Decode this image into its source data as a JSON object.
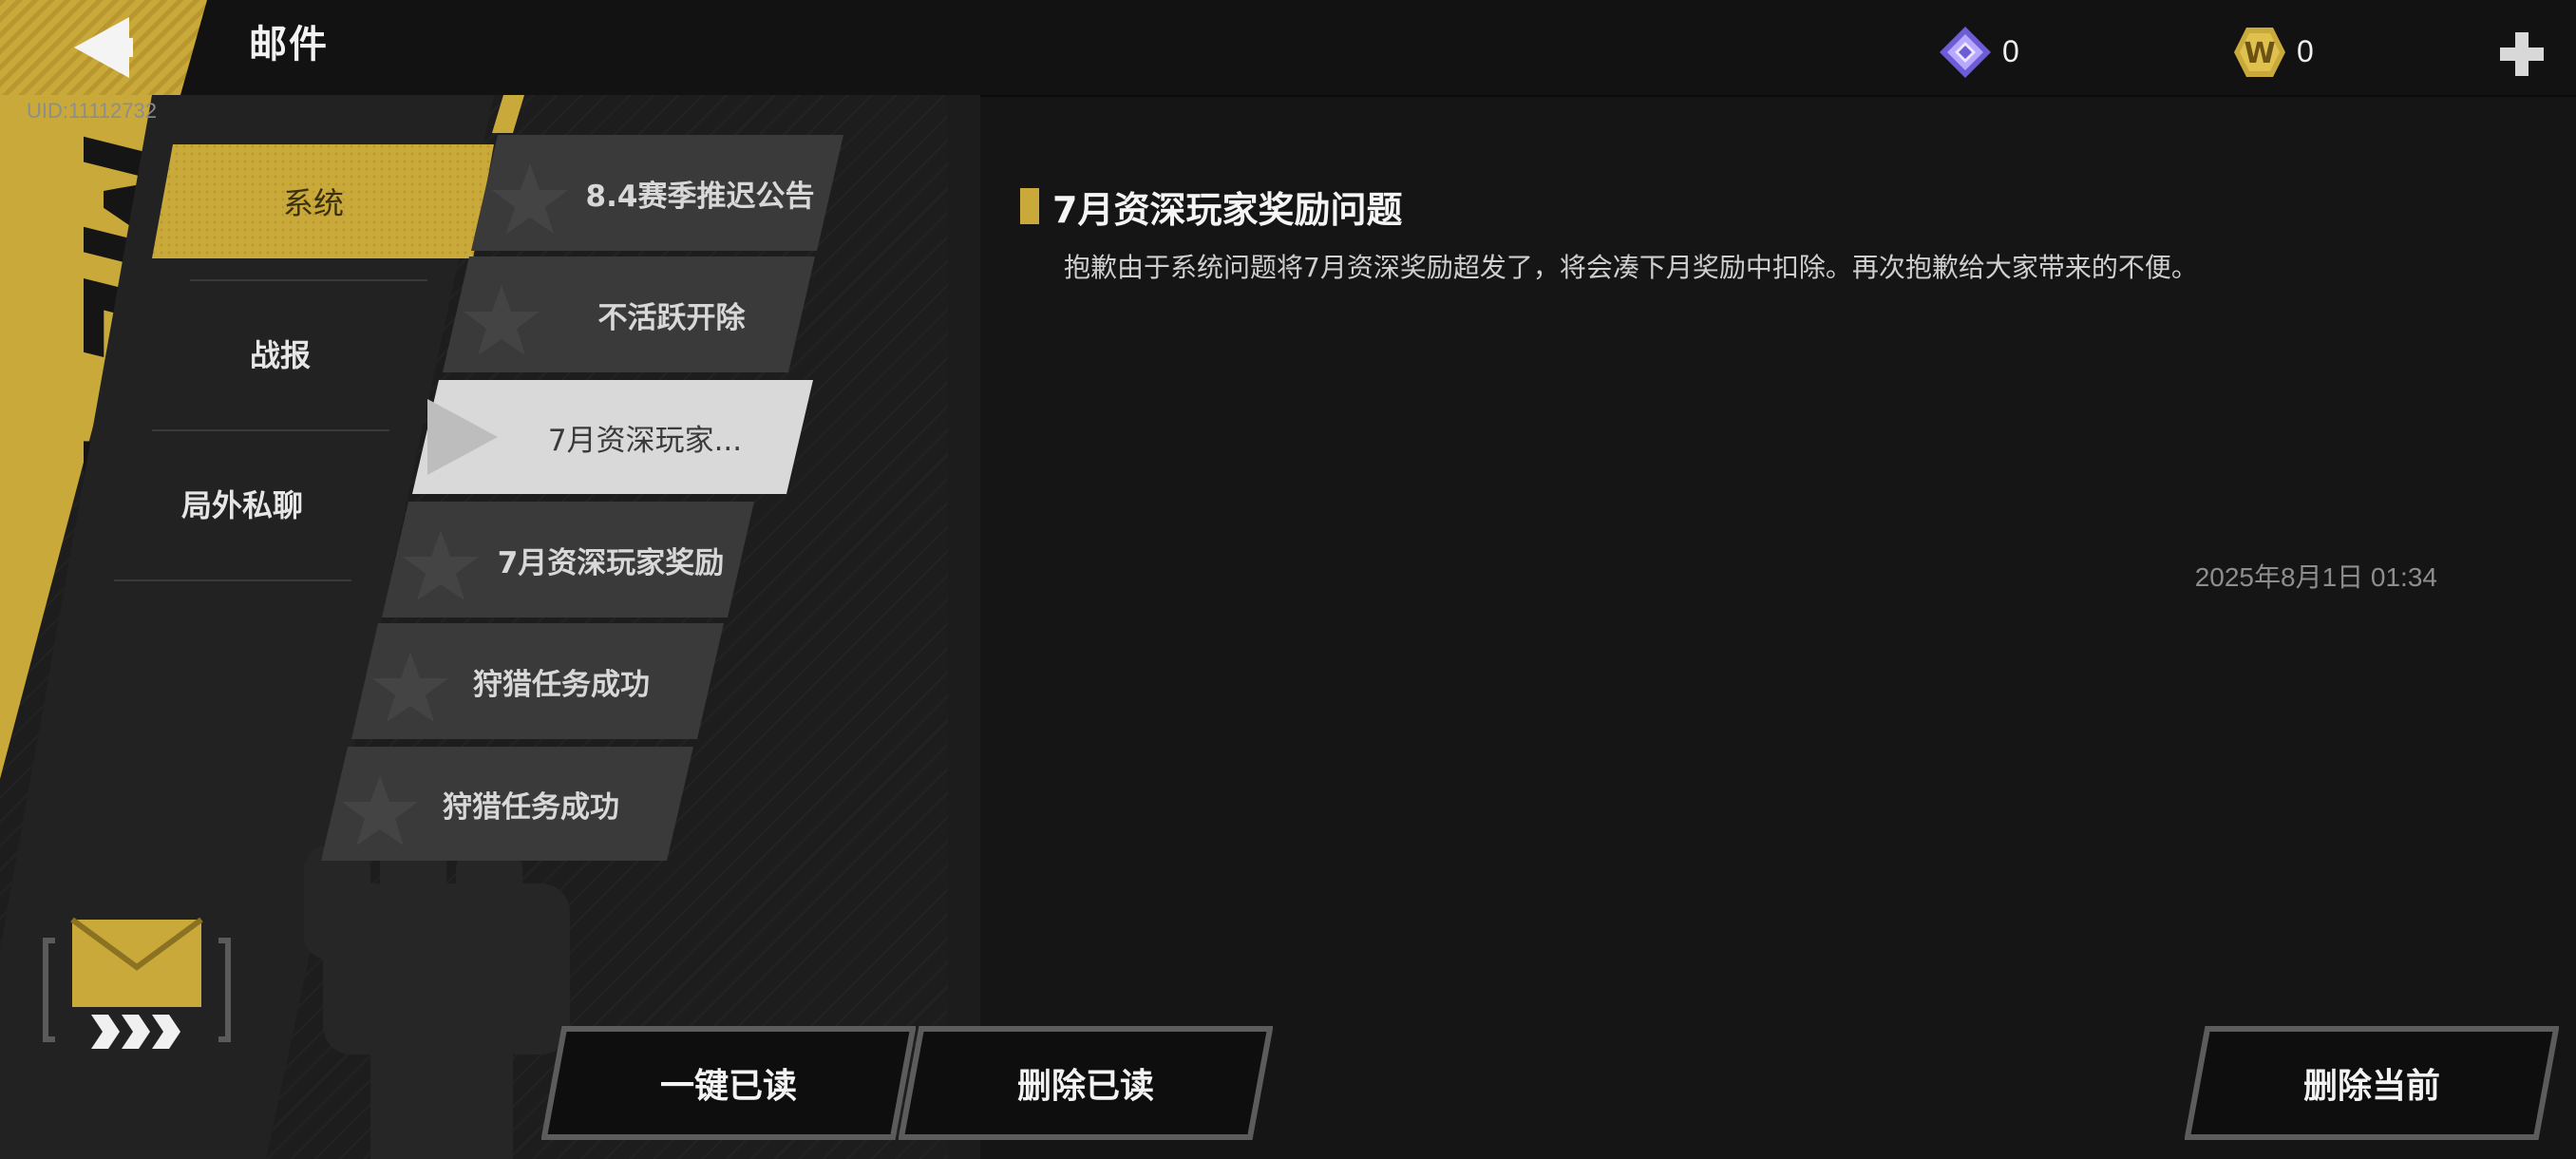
{
  "header": {
    "title": "邮件",
    "uid": "UID:11112732",
    "currencies": [
      {
        "icon": "diamond-gem-icon",
        "value": "0"
      },
      {
        "icon": "w-coin-icon",
        "value": "0"
      }
    ]
  },
  "categories": [
    {
      "label": "系统",
      "selected": true
    },
    {
      "label": "战报",
      "selected": false
    },
    {
      "label": "局外私聊",
      "selected": false
    }
  ],
  "mails": [
    {
      "label": "8.4赛季推迟公告"
    },
    {
      "label": "不活跃开除"
    },
    {
      "label": "7月资深玩家...",
      "selected": true
    },
    {
      "label": "7月资深玩家奖励"
    },
    {
      "label": "狩猎任务成功"
    },
    {
      "label": "狩猎任务成功"
    }
  ],
  "detail": {
    "title": "7月资深玩家奖励问题",
    "body": "抱歉由于系统问题将7月资深奖励超发了，将会凑下月奖励中扣除。再次抱歉给大家带来的不便。",
    "date": "2025年8月1日  01:34"
  },
  "actions": {
    "read_all": "一键已读",
    "delete_read": "删除已读",
    "delete_current": "删除当前"
  },
  "colors": {
    "accent": "#c9a93a",
    "panel": "#262626",
    "selected_mail": "#d9d9d9"
  }
}
